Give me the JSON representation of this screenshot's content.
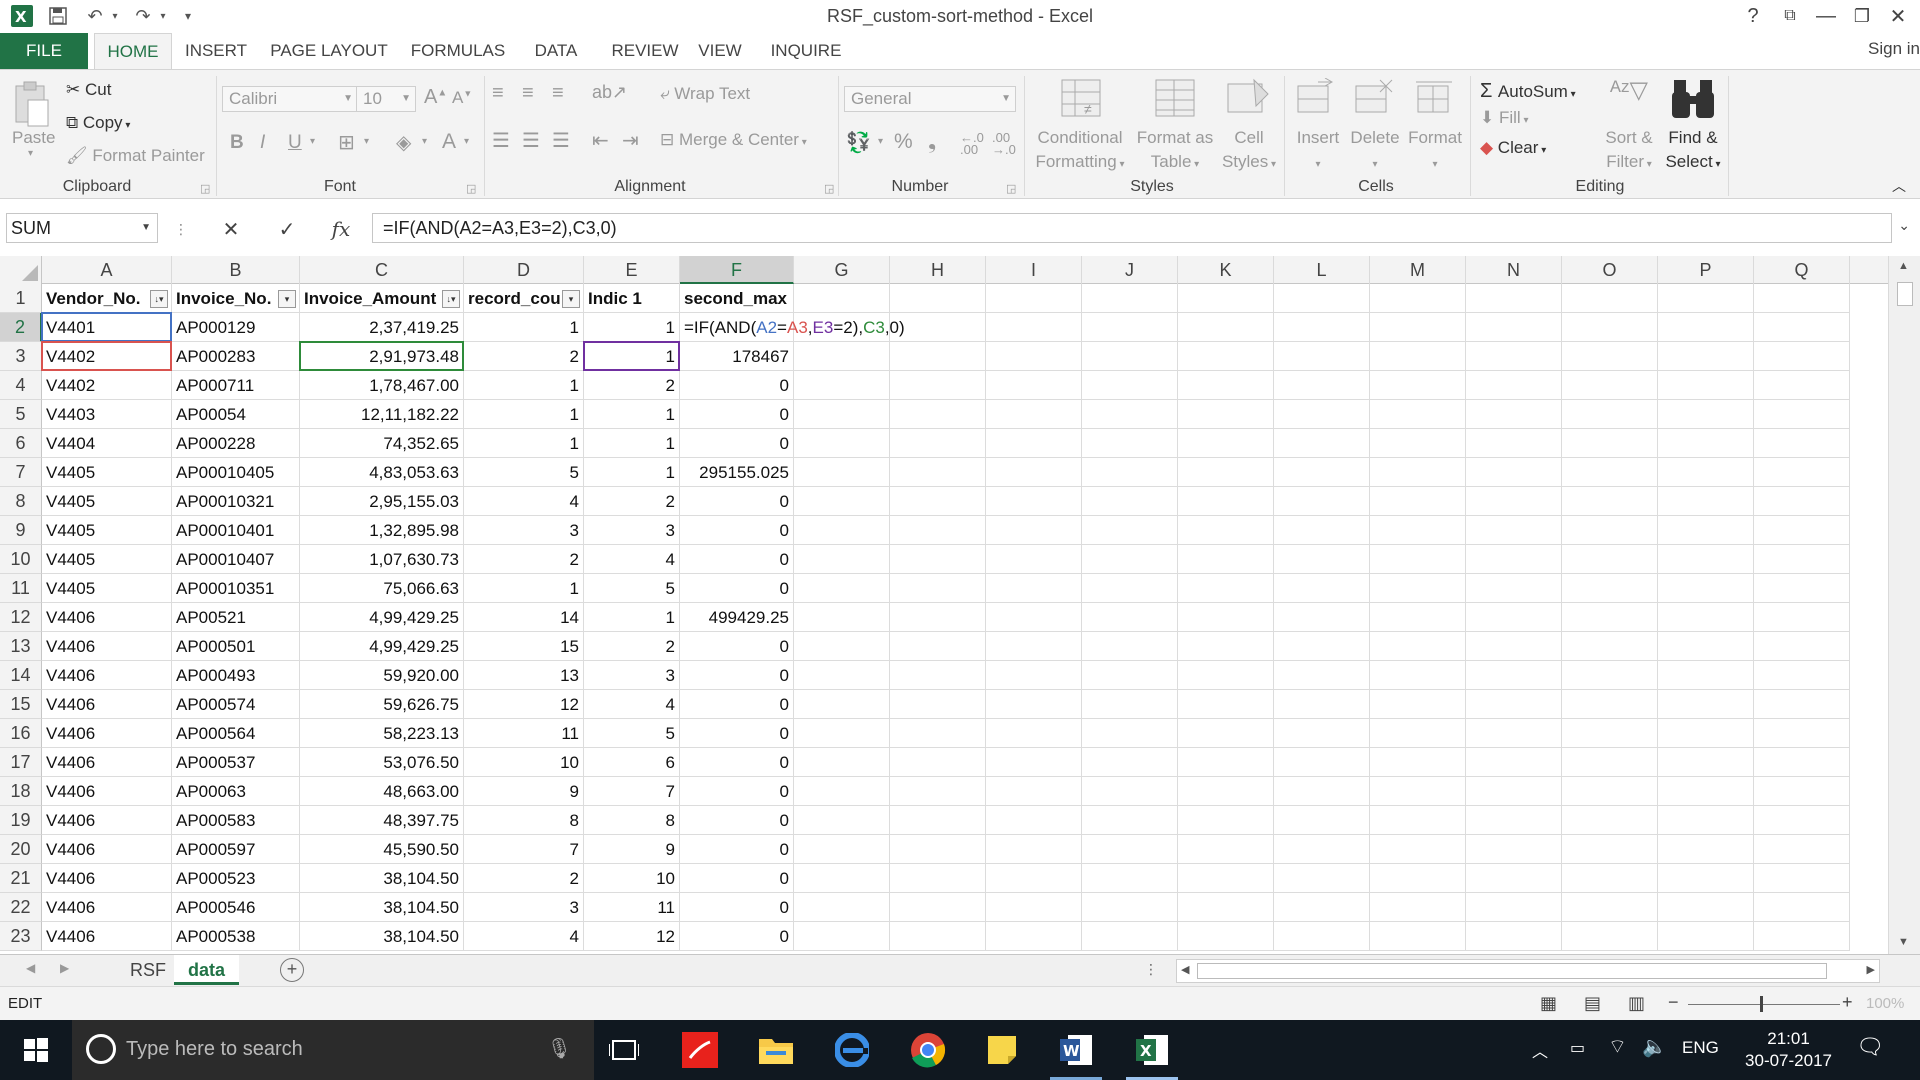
{
  "window": {
    "title": "RSF_custom-sort-method - Excel",
    "help_icon": "?",
    "controls": {
      "restore_ribbon": "⧉",
      "minimize": "—",
      "maximize": "❐",
      "close": "✕"
    }
  },
  "quick_access": {
    "undo": "↶",
    "redo": "↷",
    "customize": "▾"
  },
  "ribbon_tabs": [
    "FILE",
    "HOME",
    "INSERT",
    "PAGE LAYOUT",
    "FORMULAS",
    "DATA",
    "REVIEW",
    "VIEW",
    "INQUIRE"
  ],
  "active_tab": "HOME",
  "sign_in": "Sign in",
  "ribbon": {
    "clipboard": {
      "label": "Clipboard",
      "paste": "Paste",
      "cut": "Cut",
      "copy": "Copy",
      "format_painter": "Format Painter"
    },
    "font": {
      "label": "Font",
      "font_name": "Calibri",
      "font_size": "10",
      "grow": "A",
      "shrink": "A",
      "bold": "B",
      "italic": "I",
      "underline": "U",
      "font_color": "A"
    },
    "alignment": {
      "label": "Alignment",
      "wrap_text": "Wrap Text",
      "merge_center": "Merge & Center"
    },
    "number": {
      "label": "Number",
      "format": "General",
      "percent": "%",
      "comma": "❟"
    },
    "styles": {
      "label": "Styles",
      "conditional_formatting": [
        "Conditional",
        "Formatting"
      ],
      "format_as_table": [
        "Format as",
        "Table"
      ],
      "cell_styles": [
        "Cell",
        "Styles"
      ]
    },
    "cells": {
      "label": "Cells",
      "insert": "Insert",
      "delete": "Delete",
      "format": "Format"
    },
    "editing": {
      "label": "Editing",
      "autosum": "AutoSum",
      "fill": "Fill",
      "clear": "Clear",
      "sort_filter": [
        "Sort &",
        "Filter"
      ],
      "find_select": [
        "Find &",
        "Select"
      ]
    }
  },
  "formula_bar": {
    "name_box": "SUM",
    "cancel": "✕",
    "enter": "✓",
    "fx": "fx",
    "formula": "=IF(AND(A2=A3,E3=2),C3,0)"
  },
  "columns": [
    "A",
    "B",
    "C",
    "D",
    "E",
    "F",
    "G",
    "H",
    "I",
    "J",
    "K",
    "L",
    "M",
    "N",
    "O",
    "P",
    "Q"
  ],
  "active_column": "F",
  "active_row": 2,
  "headers": [
    "Vendor_No.",
    "Invoice_No.",
    "Invoice_Amount",
    "record_cou",
    "Indic 1",
    "second_max"
  ],
  "rows": [
    [
      "V4401",
      "AP000129",
      "2,37,419.25",
      "1",
      "1",
      "=IF(AND(A2=A3,E3=2),C3,0)"
    ],
    [
      "V4402",
      "AP000283",
      "2,91,973.48",
      "2",
      "1",
      "178467"
    ],
    [
      "V4402",
      "AP000711",
      "1,78,467.00",
      "1",
      "2",
      "0"
    ],
    [
      "V4403",
      "AP00054",
      "12,11,182.22",
      "1",
      "1",
      "0"
    ],
    [
      "V4404",
      "AP000228",
      "74,352.65",
      "1",
      "1",
      "0"
    ],
    [
      "V4405",
      "AP00010405",
      "4,83,053.63",
      "5",
      "1",
      "295155.025"
    ],
    [
      "V4405",
      "AP00010321",
      "2,95,155.03",
      "4",
      "2",
      "0"
    ],
    [
      "V4405",
      "AP00010401",
      "1,32,895.98",
      "3",
      "3",
      "0"
    ],
    [
      "V4405",
      "AP00010407",
      "1,07,630.73",
      "2",
      "4",
      "0"
    ],
    [
      "V4405",
      "AP00010351",
      "75,066.63",
      "1",
      "5",
      "0"
    ],
    [
      "V4406",
      "AP00521",
      "4,99,429.25",
      "14",
      "1",
      "499429.25"
    ],
    [
      "V4406",
      "AP000501",
      "4,99,429.25",
      "15",
      "2",
      "0"
    ],
    [
      "V4406",
      "AP000493",
      "59,920.00",
      "13",
      "3",
      "0"
    ],
    [
      "V4406",
      "AP000574",
      "59,626.75",
      "12",
      "4",
      "0"
    ],
    [
      "V4406",
      "AP000564",
      "58,223.13",
      "11",
      "5",
      "0"
    ],
    [
      "V4406",
      "AP000537",
      "53,076.50",
      "10",
      "6",
      "0"
    ],
    [
      "V4406",
      "AP00063",
      "48,663.00",
      "9",
      "7",
      "0"
    ],
    [
      "V4406",
      "AP000583",
      "48,397.75",
      "8",
      "8",
      "0"
    ],
    [
      "V4406",
      "AP000597",
      "45,590.50",
      "7",
      "9",
      "0"
    ],
    [
      "V4406",
      "AP000523",
      "38,104.50",
      "2",
      "10",
      "0"
    ],
    [
      "V4406",
      "AP000546",
      "38,104.50",
      "3",
      "11",
      "0"
    ],
    [
      "V4406",
      "AP000538",
      "38,104.50",
      "4",
      "12",
      "0"
    ]
  ],
  "sheets": [
    "RSF",
    "data"
  ],
  "active_sheet": "data",
  "add_sheet": "+",
  "status": {
    "mode": "EDIT",
    "zoom": "100%"
  },
  "taskbar": {
    "search_placeholder": "Type here to search",
    "language": "ENG",
    "time": "21:01",
    "date": "30-07-2017"
  },
  "colors": {
    "excel_green": "#217346",
    "ref_a2": "#4472c4",
    "ref_a3": "#d9534f",
    "ref_e3": "#7030a0",
    "ref_c3": "#2e8b3a"
  }
}
